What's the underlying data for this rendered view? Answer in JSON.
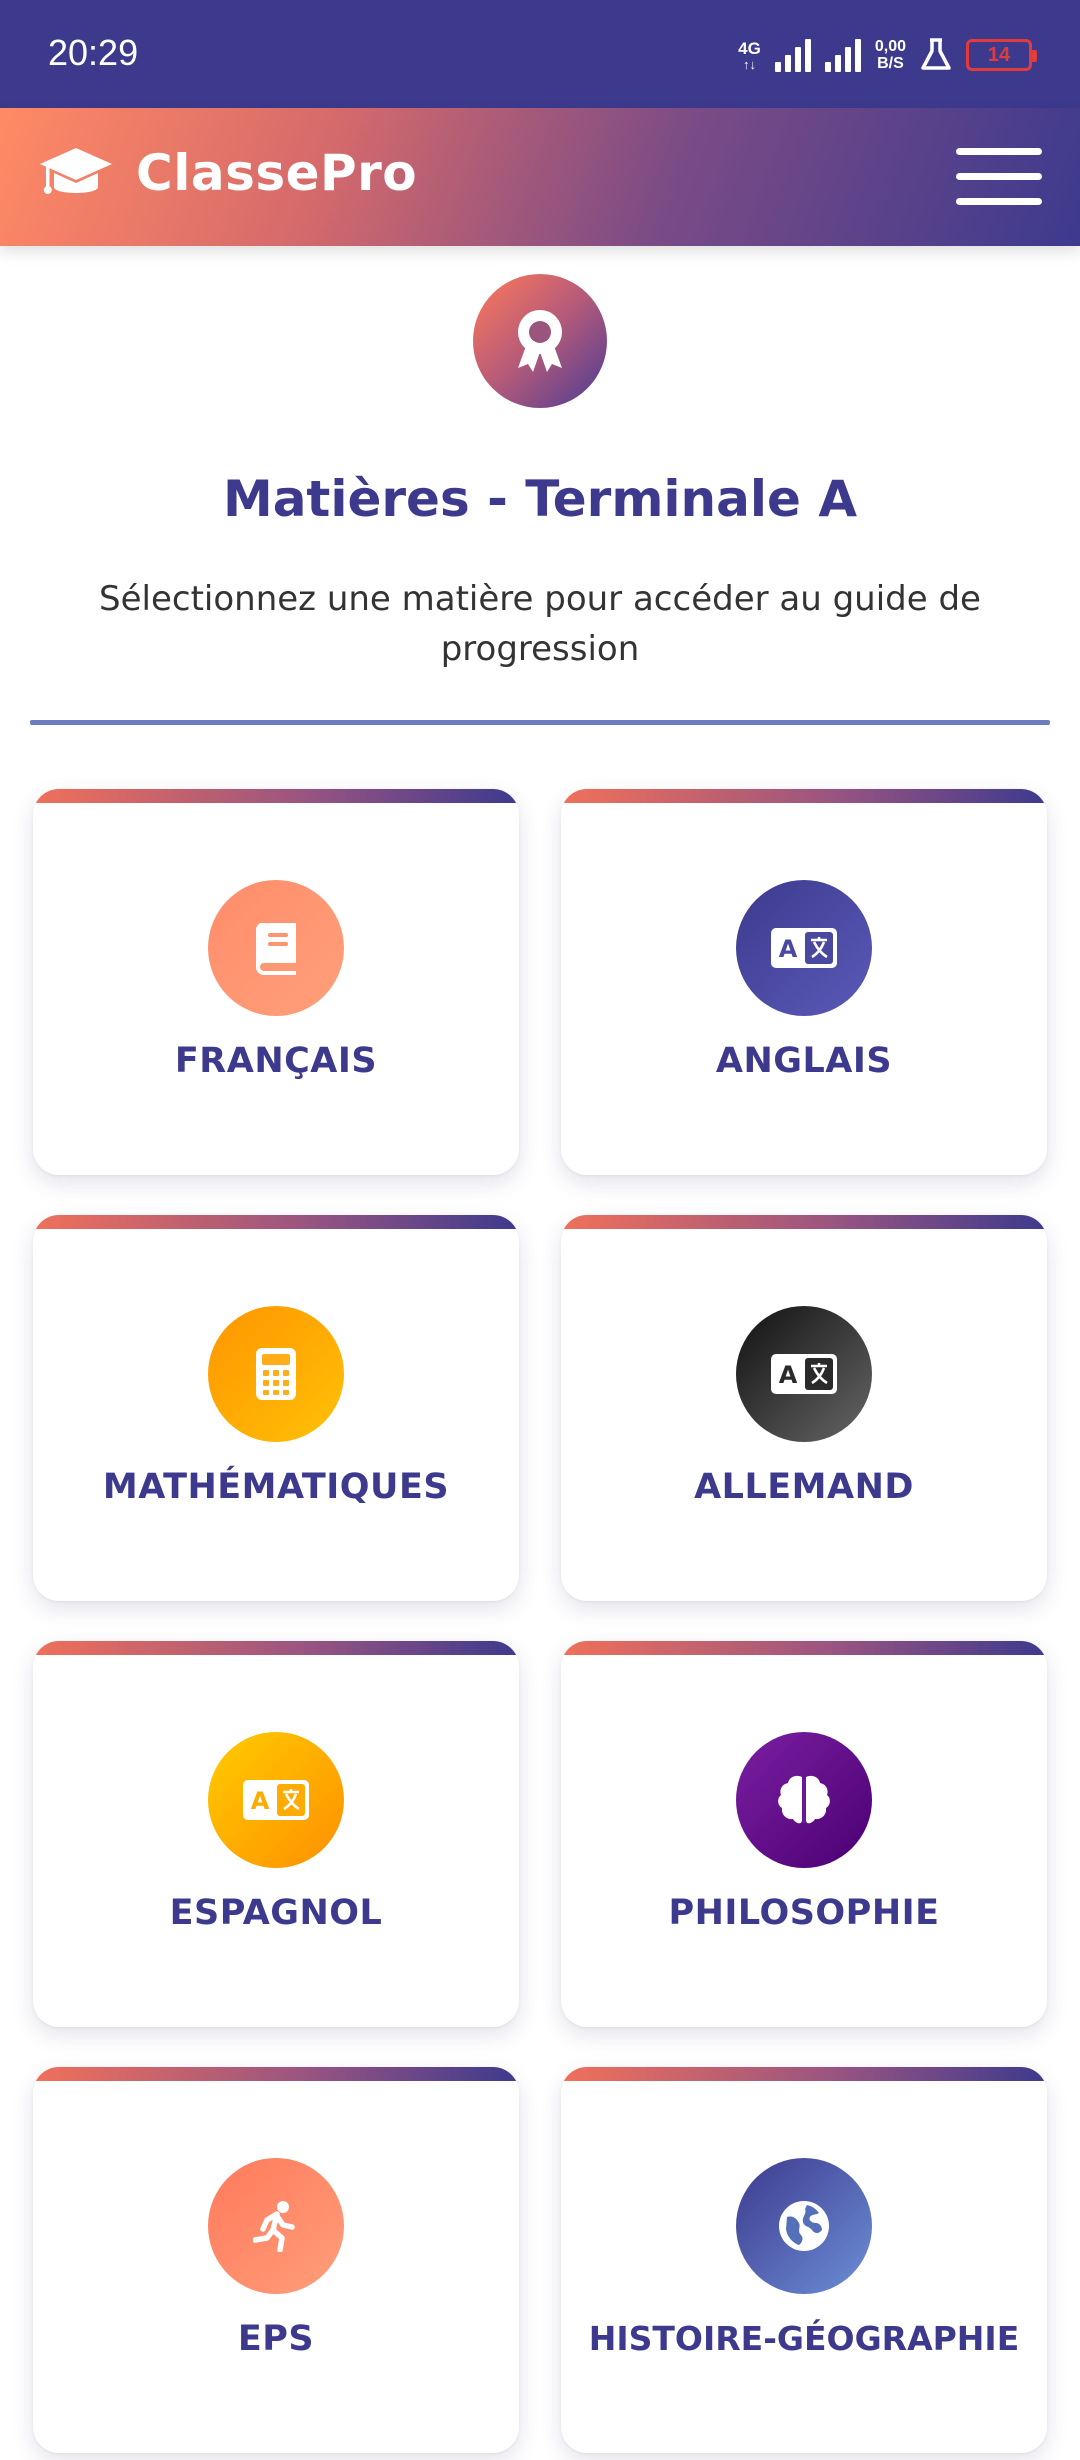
{
  "status_bar": {
    "time": "20:29",
    "network_type": "4G",
    "network_arrows": "↑↓",
    "speed_value": "0,00",
    "speed_unit": "B/S",
    "battery_level": "14"
  },
  "app_bar": {
    "brand": "ClassePro",
    "brand_icon": "graduation-cap-icon",
    "menu_icon": "hamburger-menu-icon"
  },
  "header": {
    "badge_icon": "award-ribbon-icon",
    "title": "Matières - Terminale A",
    "subtitle": "Sélectionnez une matière pour accéder au guide de progression"
  },
  "subjects": [
    {
      "label": "FRANÇAIS",
      "icon": "book-icon",
      "colors": [
        "#ff8c6b",
        "#ffa07a"
      ]
    },
    {
      "label": "ANGLAIS",
      "icon": "language-icon",
      "colors": [
        "#3d3a8e",
        "#5a5ab8"
      ]
    },
    {
      "label": "MATHÉMATIQUES",
      "icon": "calculator-icon",
      "colors": [
        "#ff9500",
        "#ffc107"
      ]
    },
    {
      "label": "ALLEMAND",
      "icon": "language-icon",
      "colors": [
        "#111111",
        "#666666"
      ]
    },
    {
      "label": "ESPAGNOL",
      "icon": "language-icon",
      "colors": [
        "#ffcc00",
        "#ff8f00"
      ]
    },
    {
      "label": "PHILOSOPHIE",
      "icon": "brain-icon",
      "colors": [
        "#7b1fa2",
        "#4a0072"
      ]
    },
    {
      "label": "EPS",
      "icon": "running-icon",
      "colors": [
        "#ff7a5c",
        "#ff9e7a"
      ]
    },
    {
      "label": "HISTOIRE-GÉOGRAPHIE",
      "icon": "globe-icon",
      "colors": [
        "#3d3a8e",
        "#6c8fd6"
      ]
    }
  ],
  "colors": {
    "primary": "#3d3a8e",
    "accent": "#ff8a65",
    "divider": "#6d7cc0"
  }
}
